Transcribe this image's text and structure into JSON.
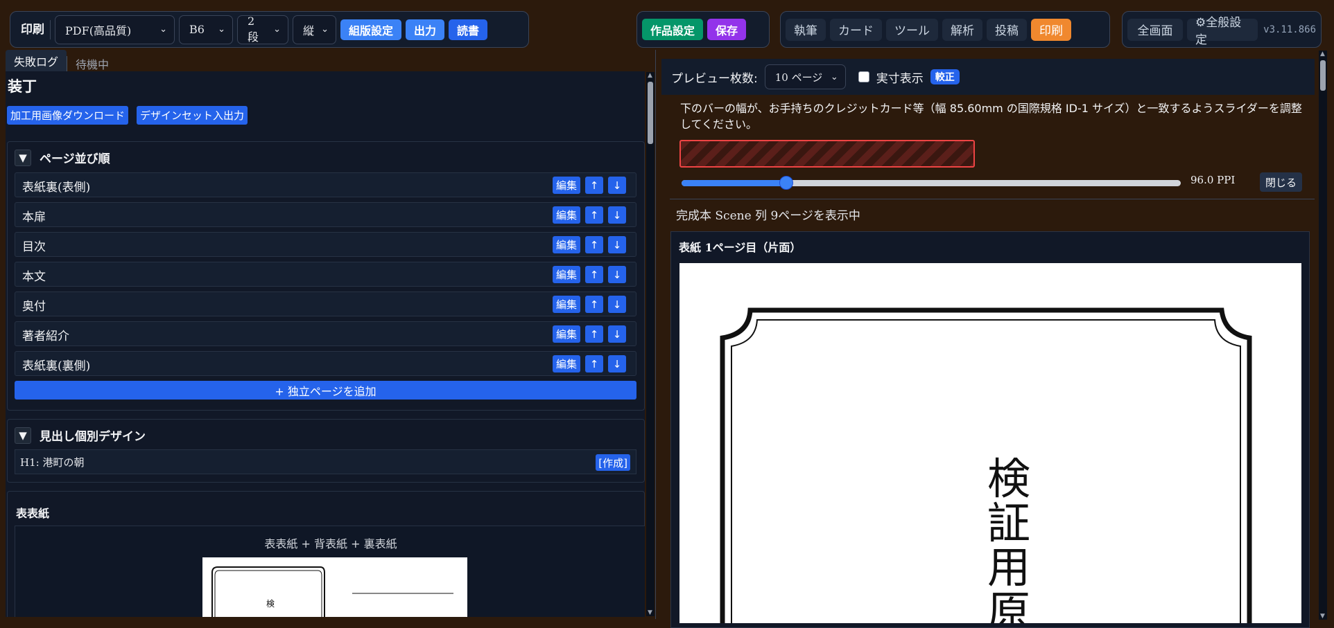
{
  "topbar": {
    "print_group": {
      "title": "印刷",
      "format": "PDF(高品質)",
      "size": "B6",
      "columns": "2 段",
      "orientation": "縦",
      "layout_settings": "組版設定",
      "output": "出力",
      "read": "読書"
    },
    "work_group": {
      "work_settings": "作品設定",
      "save": "保存"
    },
    "nav_tabs": [
      "執筆",
      "カード",
      "ツール",
      "解析",
      "投稿",
      "印刷"
    ],
    "active_tab": "印刷",
    "system": {
      "fullscreen": "全画面",
      "general_settings": "⚙全般設定",
      "version": "v3.11.866"
    }
  },
  "status_tabs": {
    "fail_log": "失敗ログ",
    "idle": "待機中"
  },
  "left": {
    "heading": "装丁",
    "download_button": "加工用画像ダウンロード",
    "designset_button": "デザインセット入出力",
    "page_order": {
      "title": "ページ並び順",
      "items": [
        "表紙裏(表側)",
        "本扉",
        "目次",
        "本文",
        "奥付",
        "著者紹介",
        "表紙裏(裏側)"
      ],
      "edit_label": "編集",
      "up_label": "↑",
      "down_label": "↓",
      "add_button": "+ 独立ページを追加"
    },
    "heading_design": {
      "title": "見出し個別デザイン",
      "row_label": "H1: 港町の朝",
      "create_label": "[作成]"
    },
    "cover": {
      "title": "表表紙",
      "caption": "表表紙 + 背表紙 + 裏表紙",
      "thumb_text": "検"
    }
  },
  "right": {
    "preview_count_label": "プレビュー枚数:",
    "preview_count_value": "10 ページ",
    "actual_size_label": "実寸表示",
    "calibrate_label": "較正",
    "description": "下のバーの幅が、お手持ちのクレジットカード等（幅 85.60mm の国際規格 ID-1 サイズ）と一致するようスライダーを調整してください。",
    "slider_fraction": 0.21,
    "ppi_value": "96.0 PPI",
    "close_label": "閉じる",
    "showing_text": "完成本 Scene 列 9ページを表示中",
    "page_title": "表紙 1ページ目（片面）",
    "vertical_text": [
      "検",
      "証",
      "用",
      "原"
    ]
  },
  "colors": {
    "accent_blue": "#3b82f6",
    "active_orange": "#f0882e",
    "save_purple": "#9333ea",
    "work_green": "#059669",
    "calib_red": "#ef4444"
  }
}
